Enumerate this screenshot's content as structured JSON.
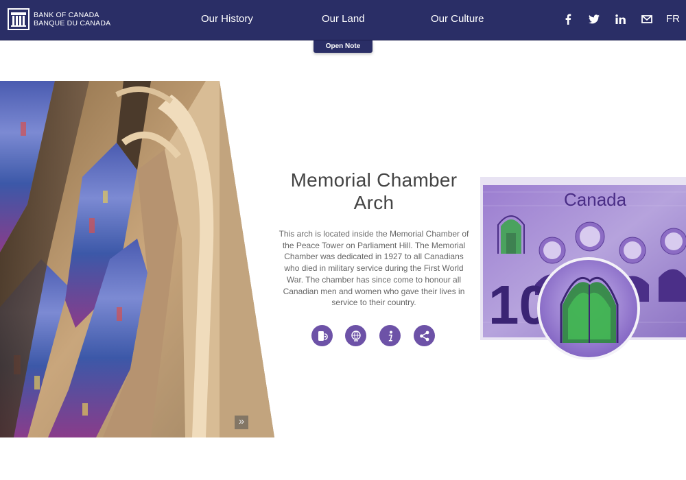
{
  "header": {
    "logo_en": "BANK OF CANADA",
    "logo_fr": "BANQUE DU CANADA",
    "nav": [
      "Our History",
      "Our Land",
      "Our Culture"
    ],
    "social_icons": [
      "facebook-icon",
      "twitter-icon",
      "linkedin-icon",
      "email-icon"
    ],
    "lang": "FR",
    "open_note": "Open Note"
  },
  "feature": {
    "title_line1": "Memorial Chamber",
    "title_line2": "Arch",
    "description": "This arch is located inside the Memorial Chamber of the Peace Tower on Parliament Hill. The Memorial Chamber was dedicated in 1927 to all Canadians who died in military service during the First World War. The chamber has since come to honour all Canadian men and women who gave their lives in service to their country.",
    "actions": [
      "phone-icon",
      "globe-icon",
      "info-icon",
      "share-icon"
    ],
    "next_icon": "double-chevron-right-icon"
  },
  "banknote": {
    "country": "Canada",
    "denomination": "10"
  },
  "colors": {
    "header_bg": "#2a2e66",
    "accent_purple": "#6d52a7"
  }
}
